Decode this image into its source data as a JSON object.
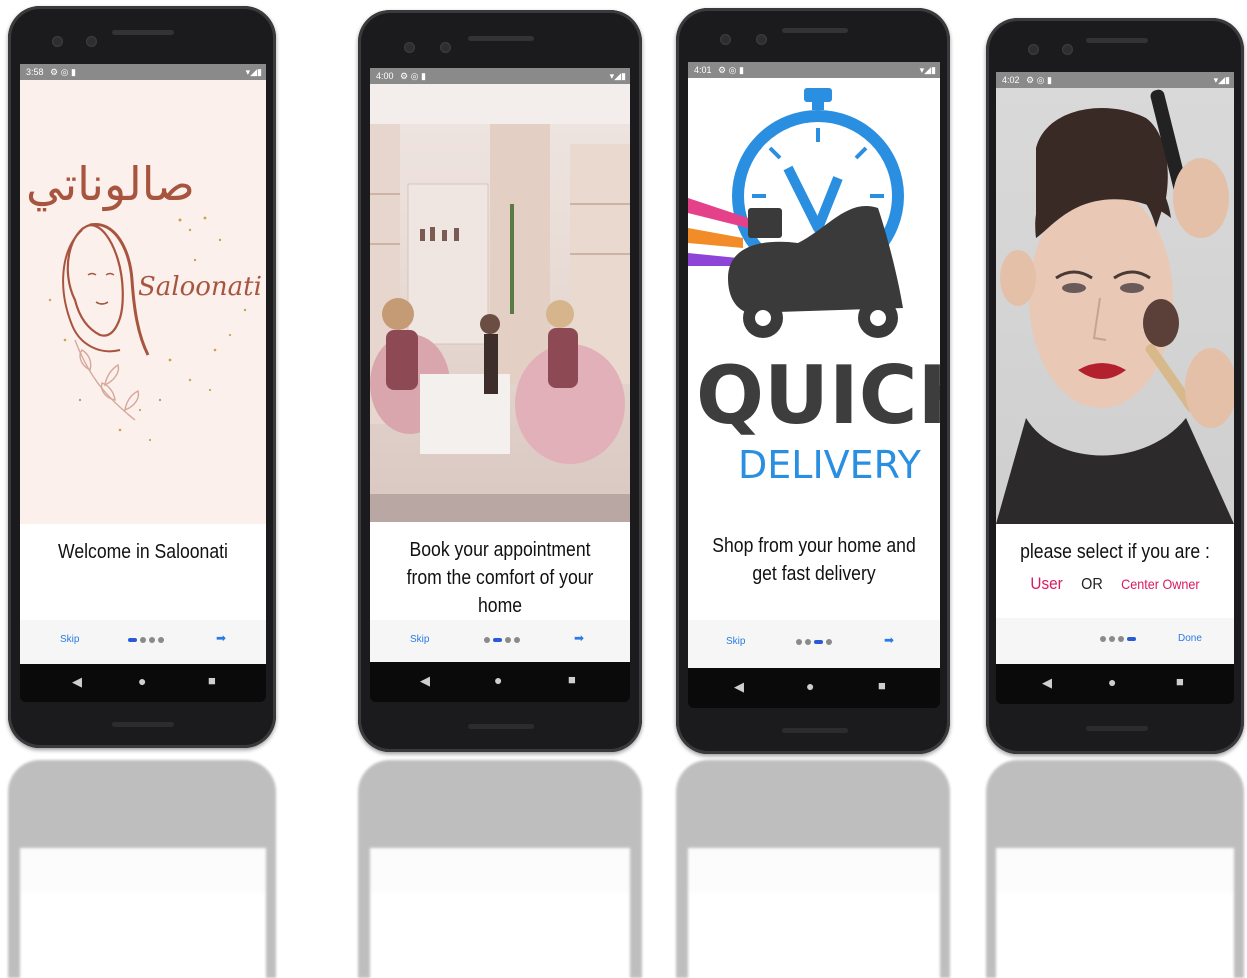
{
  "phones": [
    {
      "status_time": "3:58",
      "status_icons": "⚙ ◎ ▮",
      "title": "Welcome in Saloonati",
      "logo_text": "Saloonati",
      "logo_arabic": "صالوناتي",
      "skip_label": "Skip",
      "next_icon": "arrow-right-icon"
    },
    {
      "status_time": "4:00",
      "status_icons": "⚙ ◎ ▮",
      "title": "Book your appointment from the comfort of your home",
      "skip_label": "Skip",
      "next_icon": "arrow-right-icon"
    },
    {
      "status_time": "4:01",
      "status_icons": "⚙ ◎ ▮",
      "title": "Shop from your home and get fast delivery",
      "logo_quick": "QUICK",
      "logo_delivery": "DELIVERY",
      "skip_label": "Skip",
      "next_icon": "arrow-right-icon"
    },
    {
      "status_time": "4:02",
      "status_icons": "⚙ ◎ ▮",
      "title": "please select if you are :",
      "user_label": "User",
      "or_label": "OR",
      "owner_label": "Center Owner",
      "done_label": "Done"
    }
  ],
  "system_status_right": "▾◢▮",
  "colors": {
    "accent_blue": "#2a7be4",
    "dot_active": "#2a5bd7",
    "pink": "#d81b60",
    "logo_brown": "#a8553f"
  }
}
